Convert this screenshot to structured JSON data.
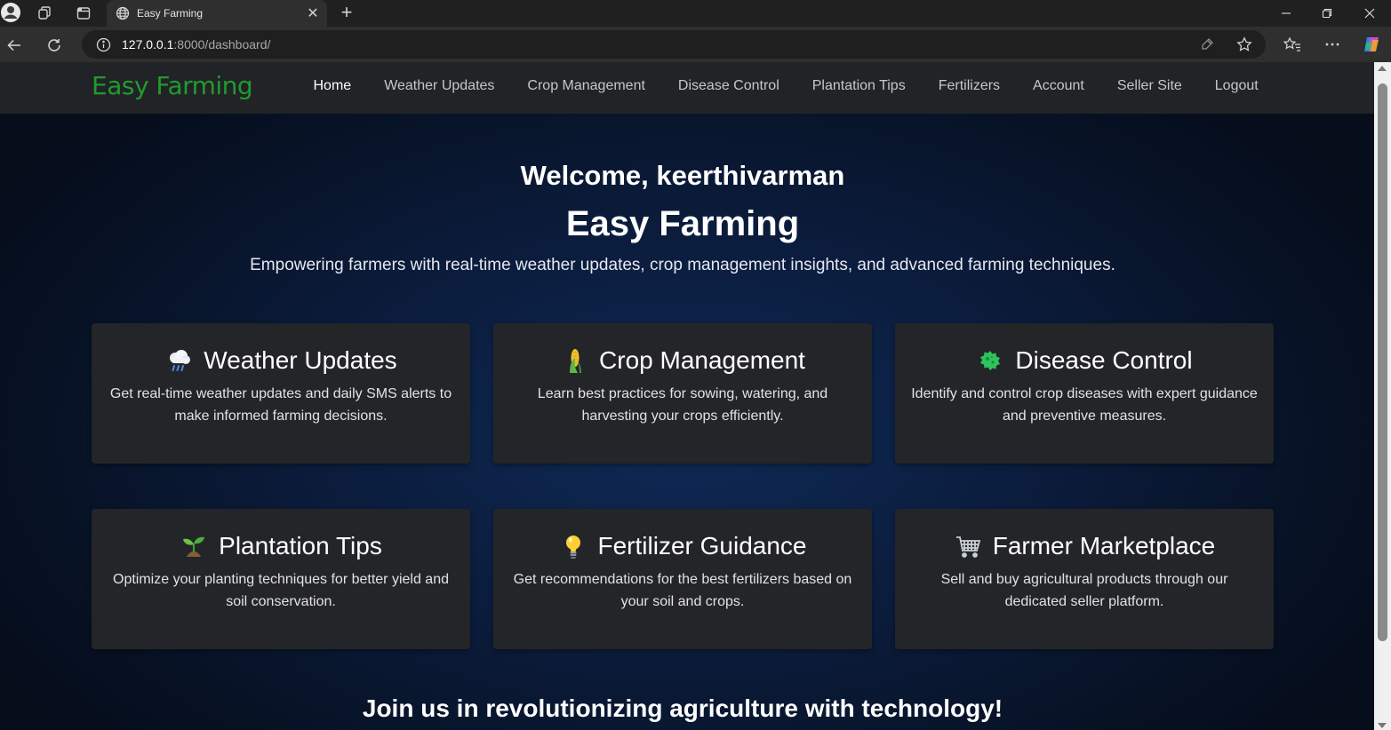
{
  "browser": {
    "tab_title": "Easy Farming",
    "url_host": "127.0.0.1",
    "url_rest": ":8000/dashboard/"
  },
  "site": {
    "brand": "Easy Farming",
    "brand_color": "#1f9b2e",
    "nav": [
      {
        "label": "Home",
        "active": true
      },
      {
        "label": "Weather Updates"
      },
      {
        "label": "Crop Management"
      },
      {
        "label": "Disease Control"
      },
      {
        "label": "Plantation Tips"
      },
      {
        "label": "Fertilizers"
      },
      {
        "label": "Account"
      },
      {
        "label": "Seller Site"
      },
      {
        "label": "Logout"
      }
    ]
  },
  "hero": {
    "welcome": "Welcome, keerthivarman",
    "title": "Easy Farming",
    "subtitle": "Empowering farmers with real-time weather updates, crop management insights, and advanced farming techniques."
  },
  "cards": [
    {
      "icon": "rain-cloud-icon",
      "title": "Weather Updates",
      "desc": "Get real-time weather updates and daily SMS alerts to make informed farming decisions."
    },
    {
      "icon": "corn-icon",
      "title": "Crop Management",
      "desc": "Learn best practices for sowing, watering, and harvesting your crops efficiently."
    },
    {
      "icon": "microbe-icon",
      "title": "Disease Control",
      "desc": "Identify and control crop diseases with expert guidance and preventive measures."
    },
    {
      "icon": "seedling-icon",
      "title": "Plantation Tips",
      "desc": "Optimize your planting techniques for better yield and soil conservation."
    },
    {
      "icon": "lightbulb-icon",
      "title": "Fertilizer Guidance",
      "desc": "Get recommendations for the best fertilizers based on your soil and crops."
    },
    {
      "icon": "shopping-cart-icon",
      "title": "Farmer Marketplace",
      "desc": "Sell and buy agricultural products through our dedicated seller platform."
    }
  ],
  "footer": {
    "join": "Join us in revolutionizing agriculture with technology!"
  }
}
